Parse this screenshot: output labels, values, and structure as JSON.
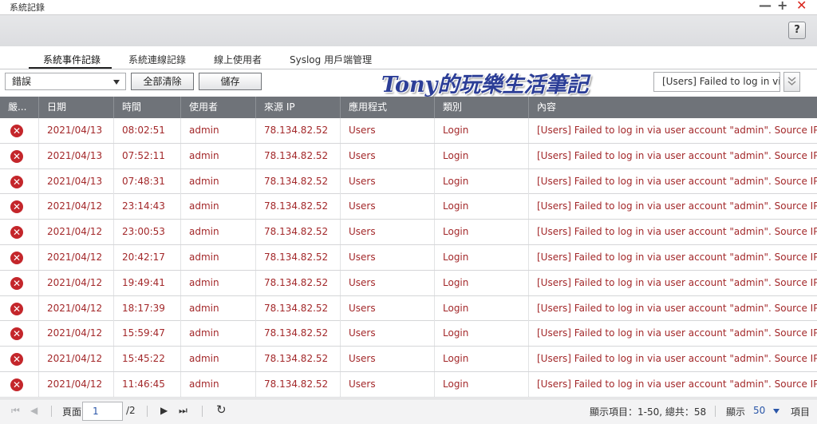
{
  "window": {
    "title": "系統記錄",
    "minimize": "—",
    "maximize": "+",
    "close": "✕",
    "help": "?"
  },
  "tabs": [
    {
      "label": "系統事件記錄",
      "active": true
    },
    {
      "label": "系統連線記錄",
      "active": false
    },
    {
      "label": "線上使用者",
      "active": false
    },
    {
      "label": "Syslog 用戶端管理",
      "active": false
    }
  ],
  "toolbar": {
    "severity_select": "錯誤",
    "clear_all_label": "全部清除",
    "save_label": "儲存",
    "search_value": "[Users] Failed to log in via",
    "filter_icon": "double-chevron-down-icon"
  },
  "watermark": "Tony的玩樂生活筆記",
  "table": {
    "headers": [
      "嚴...",
      "日期",
      "時間",
      "使用者",
      "來源 IP",
      "應用程式",
      "類別",
      "內容"
    ],
    "rows": [
      {
        "date": "2021/04/13",
        "time": "08:02:51",
        "user": "admin",
        "ip": "78.134.82.52",
        "app": "Users",
        "category": "Login",
        "content": "[Users] Failed to log in via user account \"admin\". Source IP ad..."
      },
      {
        "date": "2021/04/13",
        "time": "07:52:11",
        "user": "admin",
        "ip": "78.134.82.52",
        "app": "Users",
        "category": "Login",
        "content": "[Users] Failed to log in via user account \"admin\". Source IP ad..."
      },
      {
        "date": "2021/04/13",
        "time": "07:48:31",
        "user": "admin",
        "ip": "78.134.82.52",
        "app": "Users",
        "category": "Login",
        "content": "[Users] Failed to log in via user account \"admin\". Source IP ad..."
      },
      {
        "date": "2021/04/12",
        "time": "23:14:43",
        "user": "admin",
        "ip": "78.134.82.52",
        "app": "Users",
        "category": "Login",
        "content": "[Users] Failed to log in via user account \"admin\". Source IP ad..."
      },
      {
        "date": "2021/04/12",
        "time": "23:00:53",
        "user": "admin",
        "ip": "78.134.82.52",
        "app": "Users",
        "category": "Login",
        "content": "[Users] Failed to log in via user account \"admin\". Source IP ad..."
      },
      {
        "date": "2021/04/12",
        "time": "20:42:17",
        "user": "admin",
        "ip": "78.134.82.52",
        "app": "Users",
        "category": "Login",
        "content": "[Users] Failed to log in via user account \"admin\". Source IP ad..."
      },
      {
        "date": "2021/04/12",
        "time": "19:49:41",
        "user": "admin",
        "ip": "78.134.82.52",
        "app": "Users",
        "category": "Login",
        "content": "[Users] Failed to log in via user account \"admin\". Source IP ad..."
      },
      {
        "date": "2021/04/12",
        "time": "18:17:39",
        "user": "admin",
        "ip": "78.134.82.52",
        "app": "Users",
        "category": "Login",
        "content": "[Users] Failed to log in via user account \"admin\". Source IP ad..."
      },
      {
        "date": "2021/04/12",
        "time": "15:59:47",
        "user": "admin",
        "ip": "78.134.82.52",
        "app": "Users",
        "category": "Login",
        "content": "[Users] Failed to log in via user account \"admin\". Source IP ad..."
      },
      {
        "date": "2021/04/12",
        "time": "15:45:22",
        "user": "admin",
        "ip": "78.134.82.52",
        "app": "Users",
        "category": "Login",
        "content": "[Users] Failed to log in via user account \"admin\". Source IP ad..."
      },
      {
        "date": "2021/04/12",
        "time": "11:46:45",
        "user": "admin",
        "ip": "78.134.82.52",
        "app": "Users",
        "category": "Login",
        "content": "[Users] Failed to log in via user account \"admin\". Source IP ad..."
      }
    ]
  },
  "pager": {
    "page_label": "頁面",
    "page_value": "1",
    "total_pages": "/2",
    "display_items": "顯示項目：1-50, 總共：58",
    "show_label": "顯示",
    "per_page": "50",
    "items_label": "項目"
  },
  "colors": {
    "error_text": "#a3282a",
    "error_icon": "#c4262b",
    "header_bg": "#6f7379",
    "watermark": "#2c3e97"
  }
}
